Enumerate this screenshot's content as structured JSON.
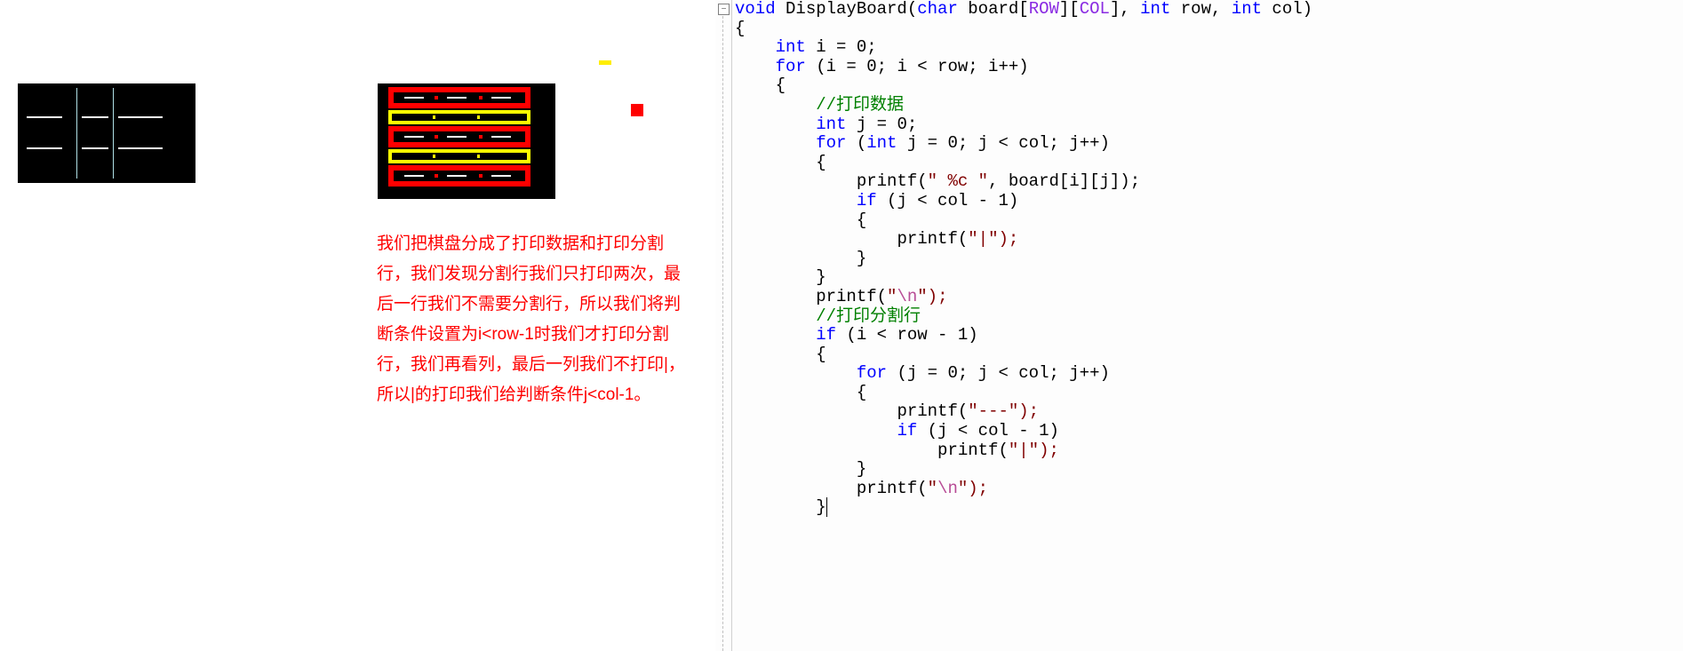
{
  "explain_text": "我们把棋盘分成了打印数据和打印分割行，我们发现分割行我们只打印两次，最后一行我们不需要分割行，所以我们将判断条件设置为i<row-1时我们才打印分割行，我们再看列，最后一列我们不打印|，所以|的打印我们给判断条件j<col-1。",
  "fold_icon": "−",
  "code": {
    "l1": {
      "kw_void": "void",
      "fn": " DisplayBoard",
      "p1": "(",
      "kw_char": "char",
      "sp": " board[",
      "m1": "ROW",
      "sp2": "][",
      "m2": "COL",
      "sp3": "], ",
      "kw_int1": "int",
      "sp4": " row, ",
      "kw_int2": "int",
      "sp5": " col)"
    },
    "l2": "{",
    "l3": {
      "indent": "    ",
      "kw": "int",
      "rest": " i = 0;"
    },
    "l4": {
      "indent": "    ",
      "kw": "for",
      "rest": " (i = 0; i < row; i++)"
    },
    "l5": "    {",
    "l6": {
      "indent": "        ",
      "cm": "//打印数据"
    },
    "l7": {
      "indent": "        ",
      "kw": "int",
      "rest": " j = 0;"
    },
    "l8": {
      "indent": "        ",
      "kw": "for",
      "rest": " (",
      "kw2": "int",
      "rest2": " j = 0; j < col; j++)"
    },
    "l9": "        {",
    "l10": {
      "indent": "            ",
      "fn": "printf(",
      "q": "\" %c \"",
      "rest": ", board[i][j]);"
    },
    "l11": {
      "indent": "            ",
      "kw": "if",
      "rest": " (j < col - 1)"
    },
    "l12": "            {",
    "l13": {
      "indent": "                ",
      "fn": "printf(",
      "q": "\"|\");"
    },
    "l14": "            }",
    "l15": "        }",
    "l16": {
      "indent": "        ",
      "fn": "printf(",
      "q1": "\"",
      "esc": "\\n",
      "q2": "\");"
    },
    "l17": {
      "indent": "        ",
      "cm": "//打印分割行"
    },
    "l18": {
      "indent": "        ",
      "kw": "if",
      "rest": " (i < row - 1)"
    },
    "l19": "        {",
    "l20": {
      "indent": "            ",
      "kw": "for",
      "rest": " (j = 0; j < col; j++)"
    },
    "l21": "            {",
    "l22": {
      "indent": "                ",
      "fn": "printf(",
      "q": "\"---\");"
    },
    "l23": {
      "indent": "                ",
      "kw": "if",
      "rest": " (j < col - 1)"
    },
    "l24": {
      "indent": "                    ",
      "fn": "printf(",
      "q": "\"|\");"
    },
    "l25": "            }",
    "l26": {
      "indent": "            ",
      "fn": "printf(",
      "q1": "\"",
      "esc": "\\n",
      "q2": "\");"
    },
    "l27": "        }"
  }
}
